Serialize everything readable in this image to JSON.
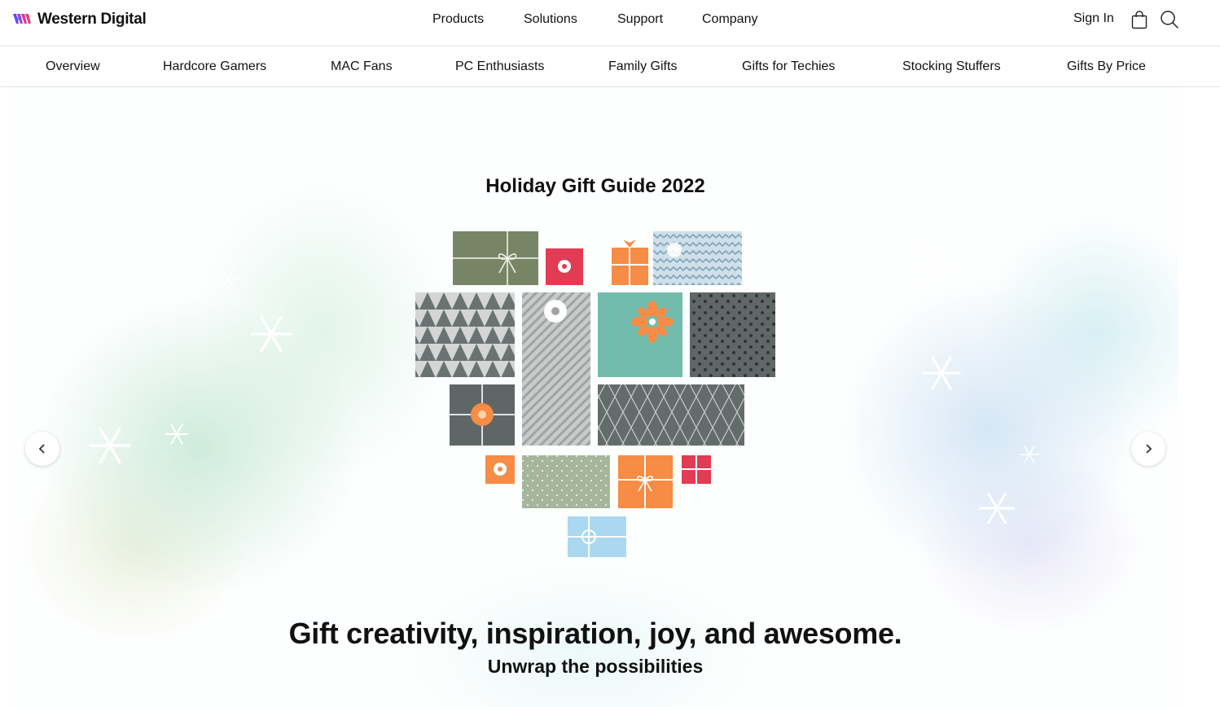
{
  "header": {
    "brand": "Western Digital",
    "nav": [
      "Products",
      "Solutions",
      "Support",
      "Company"
    ],
    "sign_in": "Sign In",
    "icons": [
      "cart-bag-icon",
      "search-icon"
    ]
  },
  "subnav": {
    "items": [
      "Overview",
      "Hardcore Gamers",
      "MAC Fans",
      "PC Enthusiasts",
      "Family Gifts",
      "Gifts for Techies",
      "Stocking Stuffers",
      "Gifts By Price"
    ]
  },
  "hero": {
    "title": "Holiday Gift Guide 2022",
    "headline": "Gift creativity, inspiration, joy, and awesome.",
    "subheadline": "Unwrap the possibilities",
    "prev_icon": "chevron-left-icon",
    "next_icon": "chevron-right-icon"
  },
  "colors": {
    "brand_purple": "#6f3df5",
    "brand_pink": "#e8337a",
    "gift_olive": "#788466",
    "gift_red": "#e23b54",
    "gift_orange": "#f68c45",
    "gift_teal": "#72bcae",
    "gift_gray": "#5f6666",
    "gift_light_blue": "#a9d8f0",
    "gift_sage": "#a6b59b"
  }
}
